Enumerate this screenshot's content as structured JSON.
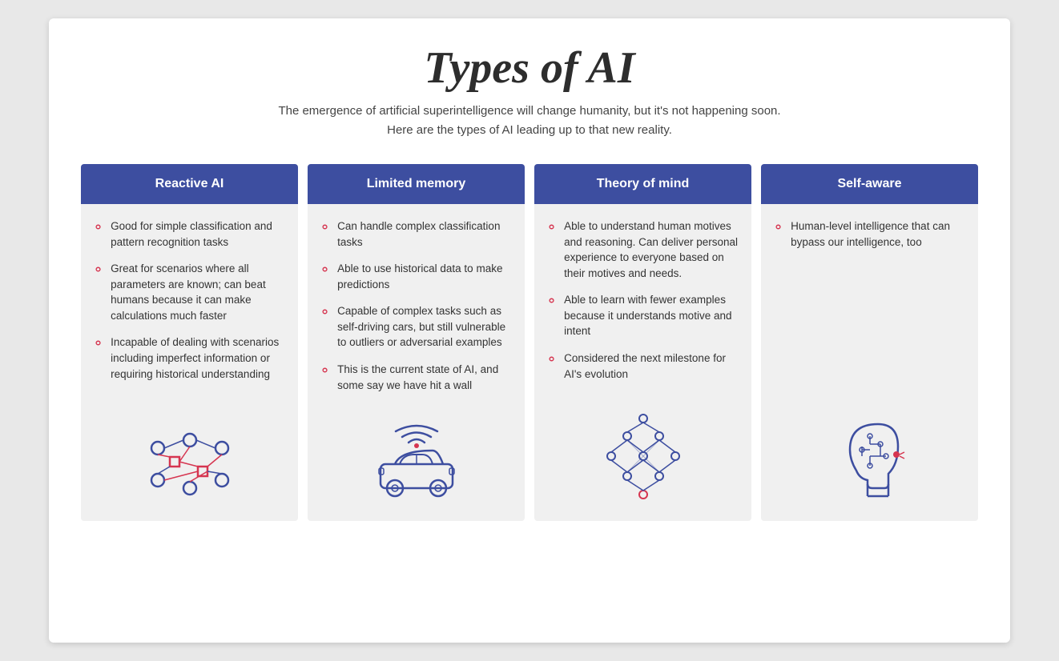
{
  "title": "Types of AI",
  "subtitle_line1": "The emergence of artificial superintelligence will change humanity, but it's not happening soon.",
  "subtitle_line2": "Here are the types of AI leading up to that new reality.",
  "columns": [
    {
      "id": "reactive",
      "header": "Reactive AI",
      "bullets": [
        "Good for simple classification and pattern recognition tasks",
        "Great for scenarios where all parameters are known; can beat humans because it can make calculations much faster",
        "Incapable of dealing with scenarios including imperfect information or requiring historical understanding"
      ]
    },
    {
      "id": "limited-memory",
      "header": "Limited memory",
      "bullets": [
        "Can handle complex classification tasks",
        "Able to use historical data to make predictions",
        "Capable of complex tasks such as self-driving cars, but still vulnerable to outliers or adversarial examples",
        "This is the current state of AI, and some say we have hit a wall"
      ]
    },
    {
      "id": "theory-of-mind",
      "header": "Theory of mind",
      "bullets": [
        "Able to understand human motives and reasoning. Can deliver personal experience to everyone based on their motives and needs.",
        "Able to learn with fewer examples because it understands motive and intent",
        "Considered the next milestone for AI's evolution"
      ]
    },
    {
      "id": "self-aware",
      "header": "Self-aware",
      "bullets": [
        "Human-level intelligence that can bypass our intelligence, too"
      ]
    }
  ]
}
